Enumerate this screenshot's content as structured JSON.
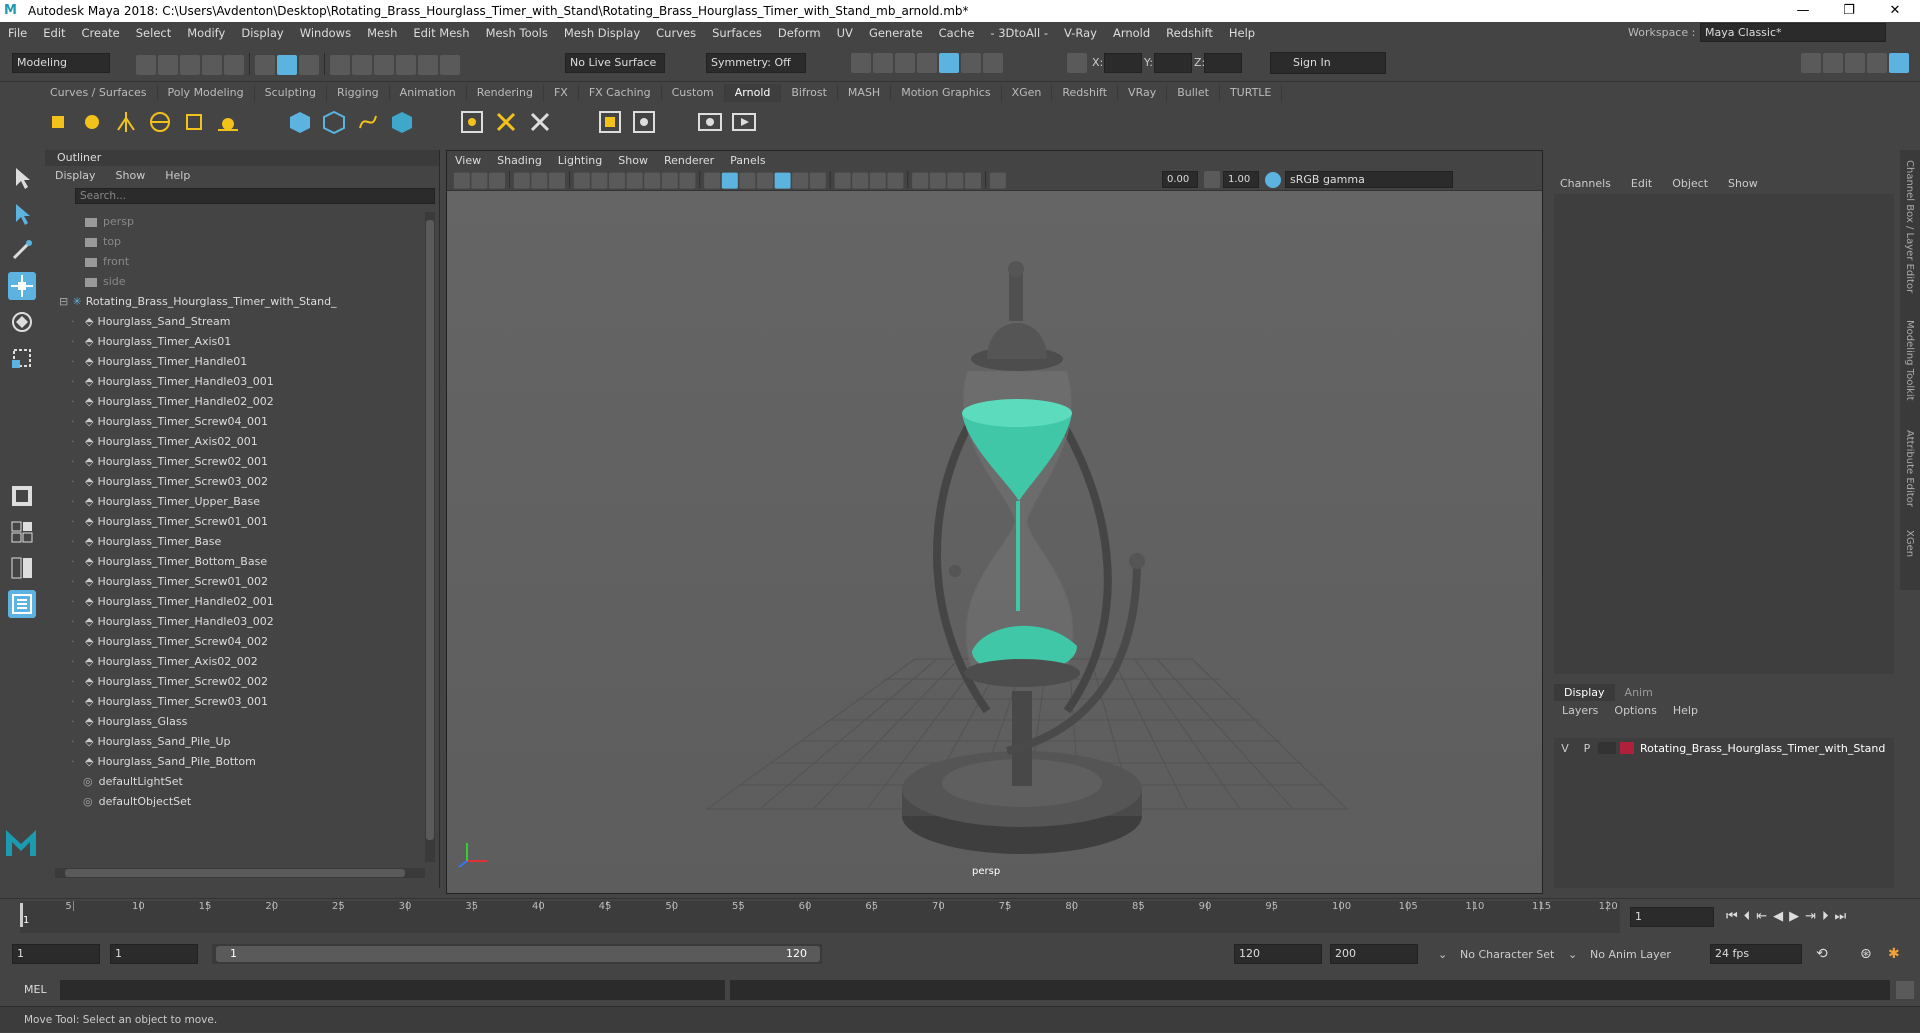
{
  "window": {
    "title": "Autodesk Maya 2018: C:\\Users\\Avdenton\\Desktop\\Rotating_Brass_Hourglass_Timer_with_Stand\\Rotating_Brass_Hourglass_Timer_with_Stand_mb_arnold.mb*"
  },
  "menu": [
    "File",
    "Edit",
    "Create",
    "Select",
    "Modify",
    "Display",
    "Windows",
    "Mesh",
    "Edit Mesh",
    "Mesh Tools",
    "Mesh Display",
    "Curves",
    "Surfaces",
    "Deform",
    "UV",
    "Generate",
    "Cache",
    "- 3DtoAll -",
    "V-Ray",
    "Arnold",
    "Redshift",
    "Help"
  ],
  "workspace": {
    "label": "Workspace :",
    "value": "Maya Classic*"
  },
  "toolbar": {
    "mode": "Modeling",
    "live_surface": "No Live Surface",
    "symmetry": "Symmetry: Off",
    "x_label": "X:",
    "y_label": "Y:",
    "z_label": "Z:",
    "sign_in": "Sign In"
  },
  "shelf_tabs": [
    "Curves / Surfaces",
    "Poly Modeling",
    "Sculpting",
    "Rigging",
    "Animation",
    "Rendering",
    "FX",
    "FX Caching",
    "Custom",
    "Arnold",
    "Bifrost",
    "MASH",
    "Motion Graphics",
    "XGen",
    "Redshift",
    "VRay",
    "Bullet",
    "TURTLE"
  ],
  "active_shelf": "Arnold",
  "outliner": {
    "title": "Outliner",
    "menu": [
      "Display",
      "Show",
      "Help"
    ],
    "search_placeholder": "Search...",
    "cameras": [
      "persp",
      "top",
      "front",
      "side"
    ],
    "group": "Rotating_Brass_Hourglass_Timer_with_Stand_",
    "items": [
      "Hourglass_Sand_Stream",
      "Hourglass_Timer_Axis01",
      "Hourglass_Timer_Handle01",
      "Hourglass_Timer_Handle03_001",
      "Hourglass_Timer_Handle02_002",
      "Hourglass_Timer_Screw04_001",
      "Hourglass_Timer_Axis02_001",
      "Hourglass_Timer_Screw02_001",
      "Hourglass_Timer_Screw03_002",
      "Hourglass_Timer_Upper_Base",
      "Hourglass_Timer_Screw01_001",
      "Hourglass_Timer_Base",
      "Hourglass_Timer_Bottom_Base",
      "Hourglass_Timer_Screw01_002",
      "Hourglass_Timer_Handle02_001",
      "Hourglass_Timer_Handle03_002",
      "Hourglass_Timer_Screw04_002",
      "Hourglass_Timer_Axis02_002",
      "Hourglass_Timer_Screw02_002",
      "Hourglass_Timer_Screw03_001",
      "Hourglass_Glass",
      "Hourglass_Sand_Pile_Up",
      "Hourglass_Sand_Pile_Bottom"
    ],
    "sets": [
      "defaultLightSet",
      "defaultObjectSet"
    ]
  },
  "viewport": {
    "menu": [
      "View",
      "Shading",
      "Lighting",
      "Show",
      "Renderer",
      "Panels"
    ],
    "field1": "0.00",
    "field2": "1.00",
    "colorspace": "sRGB gamma",
    "camera_label": "persp"
  },
  "channelbox": {
    "menu": [
      "Channels",
      "Edit",
      "Object",
      "Show"
    ]
  },
  "layers": {
    "tabs": [
      "Display",
      "Anim"
    ],
    "menu": [
      "Layers",
      "Options",
      "Help"
    ],
    "v": "V",
    "p": "P",
    "layer_name": "Rotating_Brass_Hourglass_Timer_with_Stand",
    "layer_color": "#b0203a"
  },
  "side_tabs": [
    "Channel Box / Layer Editor",
    "Modeling Toolkit",
    "Attribute Editor",
    "XGen"
  ],
  "timeline": {
    "ticks": [
      "5",
      "10",
      "15",
      "20",
      "25",
      "30",
      "35",
      "40",
      "45",
      "50",
      "55",
      "60",
      "65",
      "70",
      "75",
      "80",
      "85",
      "90",
      "95",
      "100",
      "105",
      "110",
      "115",
      "120"
    ],
    "first": "1",
    "current_frame": "1"
  },
  "range": {
    "start": "1",
    "start2": "1",
    "slider_start": "1",
    "slider_end": "120",
    "end": "120",
    "end2": "200",
    "character_set": "No Character Set",
    "anim_layer": "No Anim Layer",
    "fps": "24 fps"
  },
  "cmdline": {
    "label": "MEL"
  },
  "help_line": "Move Tool: Select an object to move.",
  "colors": {
    "sand": "#3fc7a8",
    "accent": "#5db3e0"
  }
}
